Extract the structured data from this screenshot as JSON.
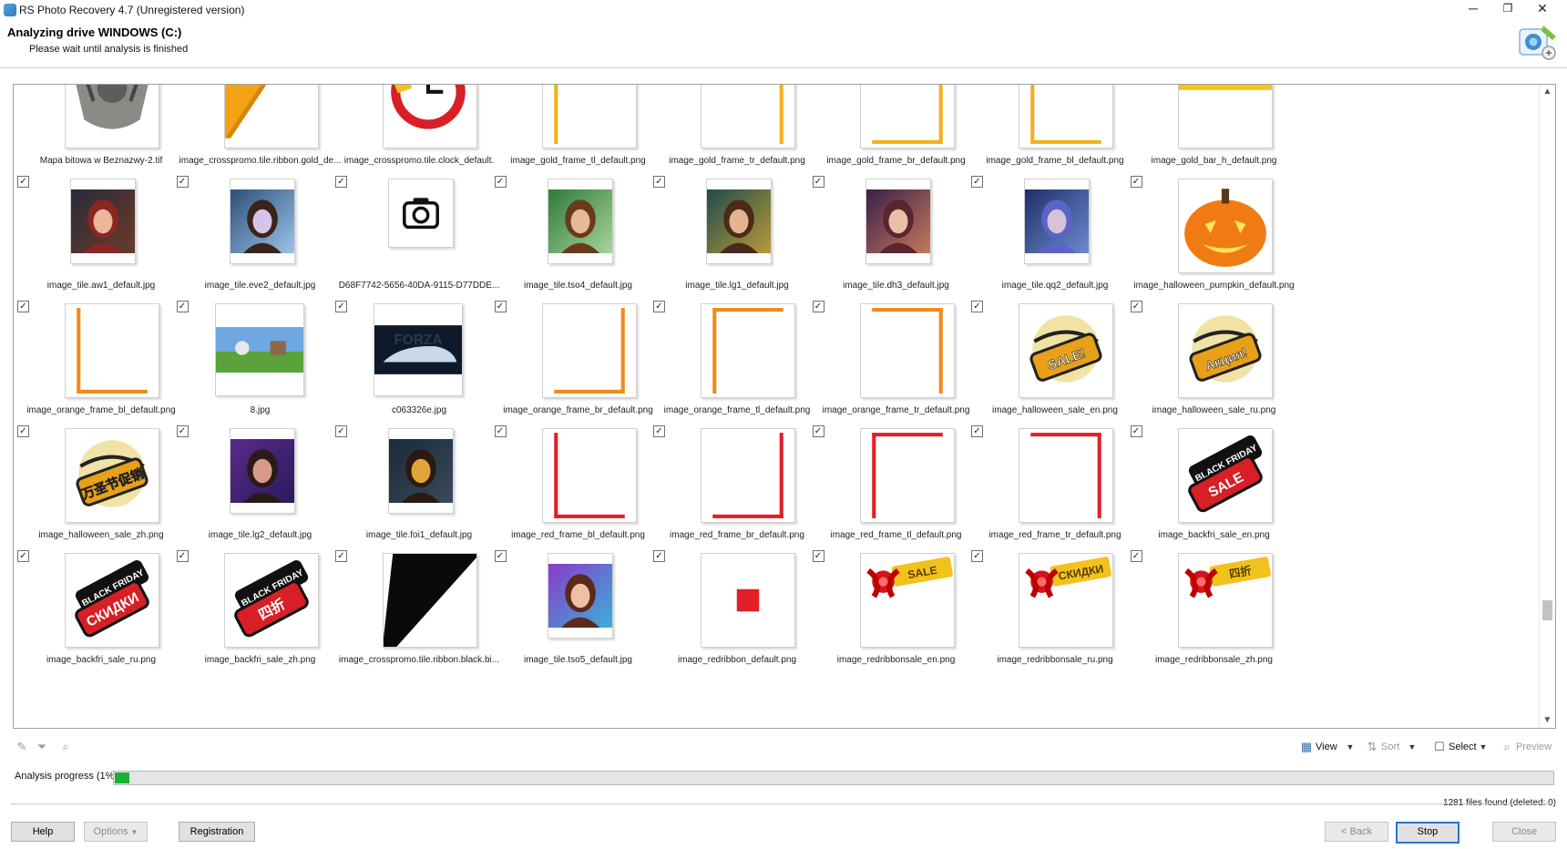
{
  "window": {
    "title": "RS Photo Recovery 4.7 (Unregistered version)",
    "controls": {
      "minimize": "─",
      "maximize": "❐",
      "close": "✕"
    }
  },
  "header": {
    "title": "Analyzing drive WINDOWS (C:)",
    "subtitle": "Please wait until analysis is finished"
  },
  "colors": {
    "accent": "#2a74d0",
    "progress": "#17b137"
  },
  "files": [
    {
      "name": "Mapa bitowa w Beznazwy-2.tif",
      "checked": false,
      "thumb": "rock-statue"
    },
    {
      "name": "image_crosspromo.tile.ribbon.gold_de...",
      "checked": false,
      "thumb": "gold-corner"
    },
    {
      "name": "image_crosspromo.tile.clock_default.",
      "checked": false,
      "thumb": "clock"
    },
    {
      "name": "image_gold_frame_tl_default.png",
      "checked": false,
      "thumb": "gold-frame-tl"
    },
    {
      "name": "image_gold_frame_tr_default.png",
      "checked": false,
      "thumb": "gold-frame-tr"
    },
    {
      "name": "image_gold_frame_br_default.png",
      "checked": false,
      "thumb": "gold-frame-br"
    },
    {
      "name": "image_gold_frame_bl_default.png",
      "checked": false,
      "thumb": "gold-frame-bl"
    },
    {
      "name": "image_gold_bar_h_default.png",
      "checked": false,
      "thumb": "gold-bar"
    },
    {
      "name": "image_tile.aw1_default.jpg",
      "checked": true,
      "thumb": "portrait-red"
    },
    {
      "name": "image_tile.eve2_default.jpg",
      "checked": true,
      "thumb": "portrait-blue"
    },
    {
      "name": "D68F7742-5656-40DA-9115-D77DDE...",
      "checked": true,
      "thumb": "camera"
    },
    {
      "name": "image_tile.tso4_default.jpg",
      "checked": true,
      "thumb": "portrait-green"
    },
    {
      "name": "image_tile.lg1_default.jpg",
      "checked": true,
      "thumb": "portrait-teal"
    },
    {
      "name": "image_tile.dh3_default.jpg",
      "checked": true,
      "thumb": "portrait-purple"
    },
    {
      "name": "image_tile.qq2_default.jpg",
      "checked": true,
      "thumb": "portrait-navy"
    },
    {
      "name": "image_halloween_pumpkin_default.png",
      "checked": true,
      "thumb": "pumpkin"
    },
    {
      "name": "image_orange_frame_bl_default.png",
      "checked": true,
      "thumb": "orange-frame-bl"
    },
    {
      "name": "8.jpg",
      "checked": true,
      "thumb": "landscape"
    },
    {
      "name": "c063326e.jpg",
      "checked": true,
      "thumb": "car"
    },
    {
      "name": "image_orange_frame_br_default.png",
      "checked": true,
      "thumb": "orange-frame-br"
    },
    {
      "name": "image_orange_frame_tl_default.png",
      "checked": true,
      "thumb": "orange-frame-tl"
    },
    {
      "name": "image_orange_frame_tr_default.png",
      "checked": true,
      "thumb": "orange-frame-tr"
    },
    {
      "name": "image_halloween_sale_en.png",
      "checked": true,
      "thumb": "halloween-badge",
      "badge": "SALE!"
    },
    {
      "name": "image_halloween_sale_ru.png",
      "checked": true,
      "thumb": "halloween-badge",
      "badge": "Акция!"
    },
    {
      "name": "image_halloween_sale_zh.png",
      "checked": true,
      "thumb": "halloween-badge",
      "badge": "万圣节促销"
    },
    {
      "name": "image_tile.lg2_default.jpg",
      "checked": true,
      "thumb": "portrait-violet"
    },
    {
      "name": "image_tile.foi1_default.jpg",
      "checked": true,
      "thumb": "portrait-mask"
    },
    {
      "name": "image_red_frame_bl_default.png",
      "checked": true,
      "thumb": "red-frame-bl"
    },
    {
      "name": "image_red_frame_br_default.png",
      "checked": true,
      "thumb": "red-frame-br"
    },
    {
      "name": "image_red_frame_tl_default.png",
      "checked": true,
      "thumb": "red-frame-tl"
    },
    {
      "name": "image_red_frame_tr_default.png",
      "checked": true,
      "thumb": "red-frame-tr"
    },
    {
      "name": "image_backfri_sale_en.png",
      "checked": true,
      "thumb": "blackfriday-badge",
      "badge": "SALE"
    },
    {
      "name": "image_backfri_sale_ru.png",
      "checked": true,
      "thumb": "blackfriday-badge",
      "badge": "СКИДКИ"
    },
    {
      "name": "image_backfri_sale_zh.png",
      "checked": true,
      "thumb": "blackfriday-badge",
      "badge": "四折"
    },
    {
      "name": "image_crosspromo.tile.ribbon.black.bi...",
      "checked": true,
      "thumb": "black-corner"
    },
    {
      "name": "image_tile.tso5_default.jpg",
      "checked": true,
      "thumb": "portrait-dragon"
    },
    {
      "name": "image_redribbon_default.png",
      "checked": true,
      "thumb": "red-square"
    },
    {
      "name": "image_redribbonsale_en.png",
      "checked": true,
      "thumb": "ribbon-sale",
      "badge": "SALE"
    },
    {
      "name": "image_redribbonsale_ru.png",
      "checked": true,
      "thumb": "ribbon-sale",
      "badge": "СКИДКИ"
    },
    {
      "name": "image_redribbonsale_zh.png",
      "checked": true,
      "thumb": "ribbon-sale",
      "badge": "四折"
    }
  ],
  "toolbar": {
    "view_label": "View",
    "sort_label": "Sort",
    "select_label": "Select",
    "preview_label": "Preview"
  },
  "progress": {
    "label": "Analysis progress (1%)",
    "percent": 1,
    "files_found": "1281 files found (deleted: 0)"
  },
  "buttons": {
    "help": "Help",
    "options": "Options",
    "registration": "Registration",
    "back": "< Back",
    "stop": "Stop",
    "close": "Close"
  }
}
